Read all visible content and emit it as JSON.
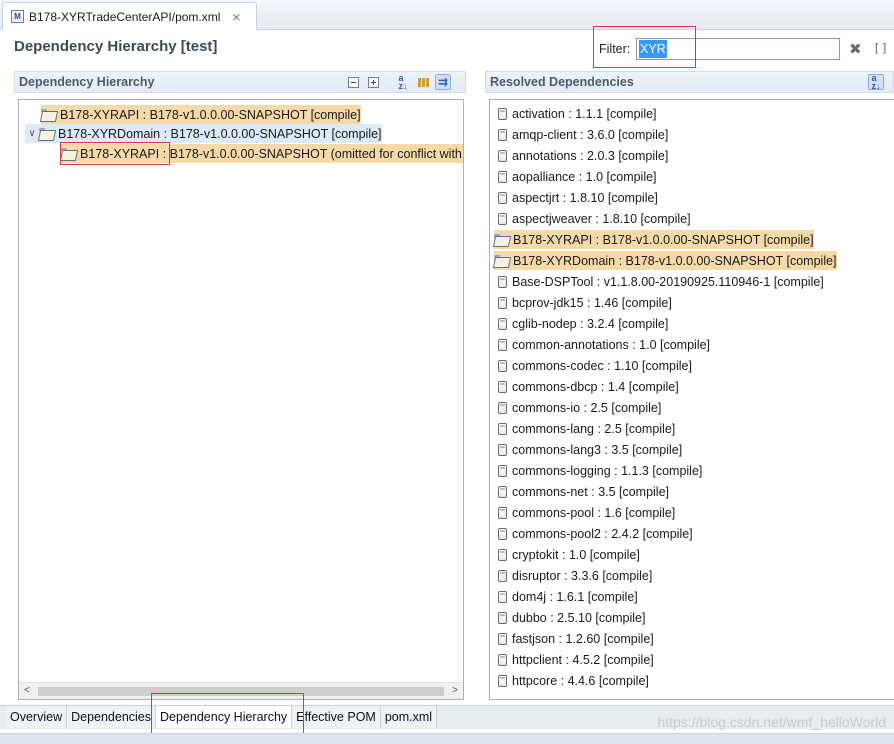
{
  "editor": {
    "tab_title": "B178-XYRTradeCenterAPI/pom.xml",
    "tab_icon": "M",
    "close_glyph": "⨯"
  },
  "header": {
    "title": "Dependency Hierarchy [test]",
    "filter_label": "Filter:",
    "filter_value": "XYR"
  },
  "hierarchy": {
    "title": "Dependency Hierarchy",
    "items": [
      {
        "label": "B178-XYRAPI : B178-v1.0.0.00-SNAPSHOT [compile]",
        "highlight": true
      },
      {
        "label": "B178-XYRDomain : B178-v1.0.0.00-SNAPSHOT [compile]",
        "expanded": true
      },
      {
        "label": "B178-XYRAPI : B178-v1.0.0.00-SNAPSHOT (omitted for conflict with",
        "highlight": true
      }
    ]
  },
  "resolved": {
    "title": "Resolved Dependencies",
    "items": [
      "activation : 1.1.1 [compile]",
      "amqp-client : 3.6.0 [compile]",
      "annotations : 2.0.3 [compile]",
      "aopalliance : 1.0 [compile]",
      "aspectjrt : 1.8.10 [compile]",
      "aspectjweaver : 1.8.10 [compile]",
      "B178-XYRAPI : B178-v1.0.0.00-SNAPSHOT [compile]",
      "B178-XYRDomain : B178-v1.0.0.00-SNAPSHOT [compile]",
      "Base-DSPTool : v1.1.8.00-20190925.110946-1 [compile]",
      "bcprov-jdk15 : 1.46 [compile]",
      "cglib-nodep : 3.2.4 [compile]",
      "common-annotations : 1.0 [compile]",
      "commons-codec : 1.10 [compile]",
      "commons-dbcp : 1.4 [compile]",
      "commons-io : 2.5 [compile]",
      "commons-lang : 2.5 [compile]",
      "commons-lang3 : 3.5 [compile]",
      "commons-logging : 1.1.3 [compile]",
      "commons-net : 3.5 [compile]",
      "commons-pool : 1.6 [compile]",
      "commons-pool2 : 2.4.2 [compile]",
      "cryptokit : 1.0 [compile]",
      "disruptor : 3.3.6 [compile]",
      "dom4j : 1.6.1 [compile]",
      "dubbo : 2.5.10 [compile]",
      "fastjson : 1.2.60 [compile]",
      "httpclient : 4.5.2 [compile]",
      "httpcore : 4.4.6 [compile]"
    ],
    "highlighted_indices": [
      6,
      7
    ]
  },
  "bottom_tabs": [
    "Overview",
    "Dependencies",
    "Dependency Hierarchy",
    "Effective POM",
    "pom.xml"
  ],
  "active_bottom_tab": "Dependency Hierarchy",
  "watermark": "https://blog.csdn.net/wmf_helloWorld",
  "colors": {
    "highlight": "#f5d9a6",
    "selection": "#dde9f8",
    "annotation_box": "#d83a3a",
    "filter_selection": "#3399ff"
  }
}
